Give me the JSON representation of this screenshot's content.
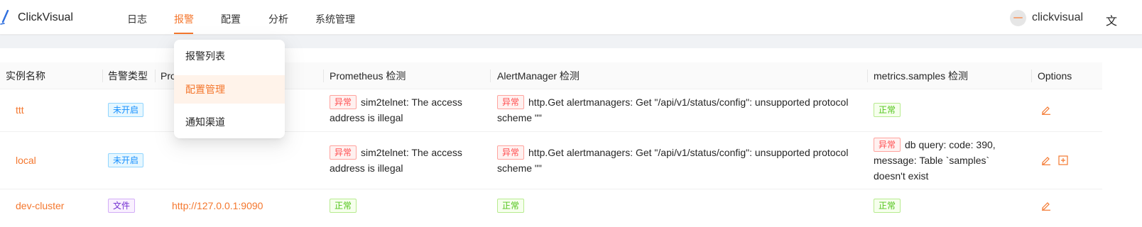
{
  "header": {
    "brand": "ClickVisual",
    "nav": [
      "日志",
      "报警",
      "配置",
      "分析",
      "系统管理"
    ],
    "active_nav": "报警",
    "username": "clickvisual",
    "lang": "文"
  },
  "dropdown": {
    "items": [
      "报警列表",
      "配置管理",
      "通知渠道"
    ],
    "active": "配置管理"
  },
  "table": {
    "columns": [
      "实例名称",
      "告警类型",
      "Pro",
      "Prometheus 检测",
      "AlertManager 检测",
      "metrics.samples 检测",
      "Options"
    ],
    "rows": [
      {
        "name": "ttt",
        "type": "未开启",
        "prometheus": "",
        "prom_check": {
          "status": "异常",
          "text": "sim2telnet: The access address is illegal"
        },
        "am_check": {
          "status": "异常",
          "text": "http.Get alertmanagers: Get \"/api/v1/status/config\": unsupported protocol scheme \"\""
        },
        "ms_check": {
          "status": "正常",
          "text": ""
        }
      },
      {
        "name": "local",
        "type": "未开启",
        "prometheus": "",
        "prom_check": {
          "status": "异常",
          "text": "sim2telnet: The access address is illegal"
        },
        "am_check": {
          "status": "异常",
          "text": "http.Get alertmanagers: Get \"/api/v1/status/config\": unsupported protocol scheme \"\""
        },
        "ms_check": {
          "status": "异常",
          "text": "db query: code: 390, message: Table `samples` doesn't exist"
        }
      },
      {
        "name": "dev-cluster",
        "type": "文件",
        "prometheus": "http://127.0.0.1:9090",
        "prom_check": {
          "status": "正常",
          "text": ""
        },
        "am_check": {
          "status": "正常",
          "text": ""
        },
        "ms_check": {
          "status": "正常",
          "text": ""
        }
      }
    ]
  },
  "icons": {
    "logo": "pen-logo-icon",
    "edit": "edit-icon",
    "add": "plus-square-icon"
  },
  "colors": {
    "accent": "#f4772e",
    "error": "#ff4d4f",
    "success": "#52c41a",
    "info": "#1890ff",
    "purple": "#722ed1"
  }
}
